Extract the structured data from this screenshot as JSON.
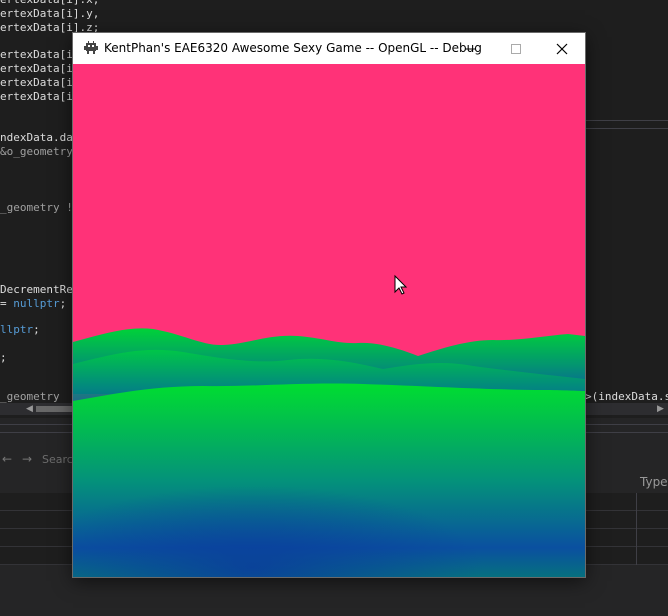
{
  "editor": {
    "lines": [
      {
        "parts": [
          {
            "t": "ertexData[i].x,",
            "c": ""
          }
        ]
      },
      {
        "parts": [
          {
            "t": "ertexData[i].y,",
            "c": ""
          }
        ]
      },
      {
        "parts": [
          {
            "t": "ertexData[i].z;",
            "c": ""
          }
        ]
      },
      {
        "parts": [
          {
            "t": "ertexData[i]",
            "c": ""
          }
        ]
      },
      {
        "parts": [
          {
            "t": "ertexData[i]",
            "c": ""
          }
        ]
      },
      {
        "parts": [
          {
            "t": "ertexData[i]",
            "c": ""
          }
        ]
      },
      {
        "parts": [
          {
            "t": "ertexData[i]",
            "c": ""
          }
        ]
      },
      {
        "parts": [
          {
            "t": "ndexData.data",
            "c": ""
          }
        ]
      },
      {
        "parts": [
          {
            "t": "&o_geometry,",
            "c": "gray"
          }
        ]
      },
      {
        "parts": [
          {
            "t": "_geometry !=",
            "c": "gray"
          }
        ]
      },
      {
        "parts": [
          {
            "t": "DecrementRefe",
            "c": ""
          }
        ]
      },
      {
        "parts": [
          {
            "t": "= ",
            "c": ""
          },
          {
            "t": "nullptr",
            "c": "blue"
          },
          {
            "t": ";",
            "c": ""
          }
        ]
      },
      {
        "parts": [
          {
            "t": "llptr",
            "c": "blue"
          },
          {
            "t": ";",
            "c": ""
          }
        ]
      },
      {
        "parts": [
          {
            "t": ";",
            "c": ""
          }
        ]
      },
      {
        "parts": [
          {
            "t": "_geometry",
            "c": "gray"
          }
        ]
      }
    ],
    "right_fragment": ">(indexData.s"
  },
  "panel": {
    "search_placeholder": "Search",
    "back_arrow": "←",
    "forward_arrow": "→",
    "type_header": "Type"
  },
  "window": {
    "title": "KentPhan's EAE6320 Awesome Sexy Game -- OpenGL -- Debug",
    "minimize_glyph": "—",
    "maximize_glyph": "☐",
    "close_glyph": "✕",
    "scene": {
      "sky_color": "#ff3278",
      "terrain_colors": [
        "#00dc32",
        "#008c78",
        "#0a46a0"
      ]
    }
  }
}
